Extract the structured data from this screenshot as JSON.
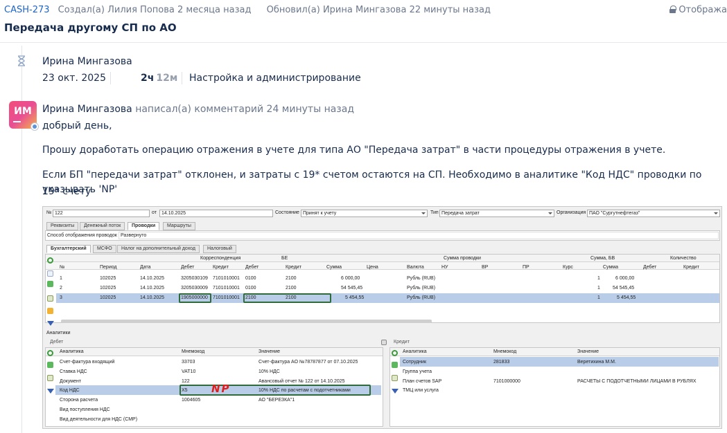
{
  "header": {
    "issue_key": "CASH-273",
    "created": "Создал(а) Лилия Попова 2 месяца назад",
    "updated": "Обновил(а) Ирина Мингазова 22 минуты назад",
    "visibility": "Отобража",
    "title": "Передача другому СП по АО"
  },
  "worklog": {
    "author": "Ирина Мингазова",
    "date": "23 окт. 2025",
    "hours": "2ч",
    "minutes": "12м",
    "category": "Настройка и администрирование"
  },
  "comment": {
    "avatar_initials": "ИМ",
    "author": "Ирина Мингазова",
    "action": "написал(а) комментарий 24 минуты назад",
    "p1": "добрый день,",
    "p2": "Прошу доработать операцию отражения в учете для типа АО \"Передача затрат\" в части процедуры отражения в учете.",
    "p3a": "Если БП \"передачи затрат\" отклонен, и затраты с 19* счетом остаются на СП. Необходимо в аналитике \"Код НДС\" проводки по 19* счету",
    "p3b": "указывать 'NP'"
  },
  "screenshot": {
    "top": {
      "num_label": "№",
      "num": "122",
      "from_label": "от",
      "date": "14.10.2025",
      "state_label": "Состояние",
      "state": "Принят к учету",
      "type_label": "Тип",
      "type": "Передача затрат",
      "org_label": "Организация",
      "org": "ПАО \"Сургутнефтегаз\""
    },
    "tabs": [
      "Реквизиты",
      "Денежный поток",
      "Проводки",
      "Маршруты"
    ],
    "display_label": "Способ отображения проводок",
    "display_value": "Развернуто",
    "subtabs": [
      "Бухгалтерский",
      "МСФО",
      "Налог на дополнительный доход",
      "Налоговый"
    ],
    "groups": [
      "Корреспонденция",
      "БЕ",
      "Сумма проводки",
      "Сумма, БВ",
      "Количество"
    ],
    "columns": [
      "№",
      "Период",
      "Дата",
      "Дебет",
      "Кредит",
      "Дебет",
      "Кредит",
      "Сумма",
      "Цена",
      "Валюта",
      "НУ",
      "ВР",
      "ПР",
      "Курс",
      "Сумма",
      "Дебет",
      "Кредит"
    ],
    "rows": [
      {
        "n": "1",
        "period": "102025",
        "date": "14.10.2025",
        "deb": "3205030109",
        "cred": "7101010001",
        "be_d": "0100",
        "be_c": "2100",
        "sum": "6 000,00",
        "cur": "Рубль (RUB)",
        "rate": "1",
        "sum_bv": "6 000,00"
      },
      {
        "n": "2",
        "period": "102025",
        "date": "14.10.2025",
        "deb": "3205030009",
        "cred": "7101010001",
        "be_d": "0100",
        "be_c": "2100",
        "sum": "54 545,45",
        "cur": "Рубль (RUB)",
        "rate": "1",
        "sum_bv": "54 545,45"
      },
      {
        "n": "3",
        "period": "102025",
        "date": "14.10.2025",
        "deb": "1905000000",
        "cred": "7101010001",
        "be_d": "2100",
        "be_c": "2100",
        "sum": "5 454,55",
        "cur": "Рубль (RUB)",
        "rate": "1",
        "sum_bv": "5 454,55"
      }
    ],
    "analytics_label": "Аналитики",
    "debit_label": "Дебет",
    "credit_label": "Кредит",
    "an_cols": [
      "Аналитика",
      "Мнемокод",
      "Значение"
    ],
    "debit_rows": [
      [
        "Счет-фактура входящий",
        "33703",
        "Счет-фактура АО №78787877 от 07.10.2025"
      ],
      [
        "Ставка НДС",
        "VAT10",
        "10% НДС"
      ],
      [
        "Документ",
        "122",
        "Авансовый отчет № 122 от 14.10.2025"
      ],
      [
        "Код НДС",
        "X5",
        "10% НДС по расчетам с подотчетниками"
      ],
      [
        "Сторона расчета",
        "1004605",
        "АО \"БЕРЕЗКА\"1"
      ],
      [
        "Вид поступления НДС",
        "",
        ""
      ],
      [
        "Вид деятельности для НДС (СМР)",
        "",
        ""
      ]
    ],
    "credit_rows": [
      [
        "Сотрудник",
        "281833",
        "Веретихина М.М."
      ],
      [
        "Группа учета",
        "",
        ""
      ],
      [
        "План счетов SAP",
        "7101000000",
        "РАСЧЕТЫ С ПОДОТЧЕТНЫМИ ЛИЦАМИ В РУБЛЯХ"
      ],
      [
        "ТМЦ или услуга",
        "",
        ""
      ]
    ],
    "annotation": "NP"
  },
  "colors": {
    "link": "#1d64c8",
    "muted": "#6b778c",
    "row_selected": "#b9cde9",
    "annotation": "#e01e1e",
    "highlight": "#2e6a3a"
  }
}
